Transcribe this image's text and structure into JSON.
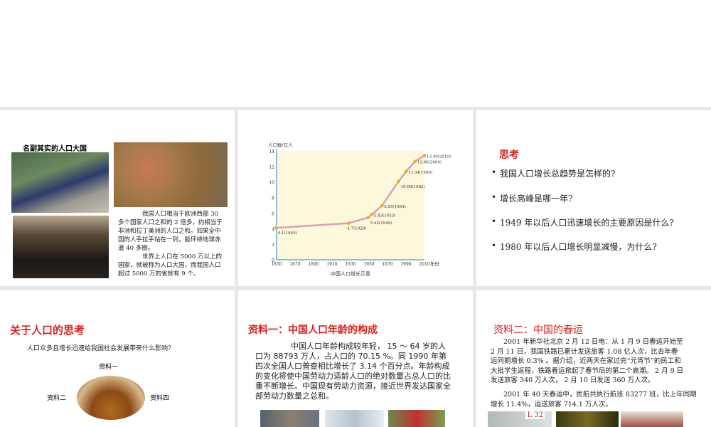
{
  "slide1": {
    "title": "名副其实的人口大国",
    "para1": "我国人口相当于欧洲西部 30 多个国家人口之和的 2 倍多，约相当于非洲和拉丁美洲的人口之和。如果全中国的人手拉手站在一列，能环绕地球赤道 40 多圈。",
    "para2": "世界上人口在 5000 万以上的国家，就被称为人口大国，而我国人口超过 5000 万的省就有 9 个。"
  },
  "chart_data": {
    "type": "line",
    "title": "中国人口增长示意",
    "ylabel": "人口数/亿人",
    "xlabel": "年份",
    "xlim": [
      1850,
      2010
    ],
    "ylim": [
      0,
      14
    ],
    "xticks": [
      "1850",
      "1870",
      "1890",
      "1910",
      "1930",
      "1950",
      "1970",
      "1990",
      "2010"
    ],
    "yticks": [
      "0",
      "2",
      "4",
      "6",
      "8",
      "10",
      "12",
      "14"
    ],
    "points": [
      {
        "year": 1849,
        "value": 4.1,
        "label": "4.1(1849)"
      },
      {
        "year": 1928,
        "value": 4.7,
        "label": "4.7(1928)"
      },
      {
        "year": 1949,
        "value": 5.42,
        "label": "5.42(1949)"
      },
      {
        "year": 1953,
        "value": 5.83,
        "label": "5.83(1953)"
      },
      {
        "year": 1964,
        "value": 6.95,
        "label": "6.95(1964)"
      },
      {
        "year": 1982,
        "value": 10.08,
        "label": "10.08(1982)"
      },
      {
        "year": 1990,
        "value": 11.34,
        "label": "11.34(1990)"
      },
      {
        "year": 2000,
        "value": 12.66,
        "label": "12.66(2000)"
      },
      {
        "year": 2010,
        "value": 13.4,
        "label": "13.40(2010)"
      }
    ],
    "line_color": "#d9a0b8",
    "point_color": "#f0a830",
    "bg_color": "#fdf8dc"
  },
  "slide3": {
    "title": "思考",
    "questions": [
      "我国人口增长总趋势是怎样的?",
      "增长高峰是哪一年?",
      "1949 年以后人口迅速增长的主要原因是什么?",
      "1980 年以后人口增长明显减慢，为什么?"
    ]
  },
  "slide4": {
    "title": "关于人口的思考",
    "question": "人口众多且增长迅速给我国社会发展带来什么影响?",
    "m1": "资料一",
    "m2": "资料二",
    "m4": "资料四"
  },
  "slide5": {
    "title": "资料一：中国人口年龄的构成",
    "body": "中国人口年龄构成较年轻， 15 ～ 64 岁的人口为 88793 万人，占人口的 70.15 %。同 1990 年第四次全国人口普查相比增长了 3.14 个百分点。年龄构成的变化将使中国劳动力适龄人口的绝对数量占总人口的比重不断增长。中国现有劳动力资源，接近世界发达国家全部劳动力数量之总和。"
  },
  "slide6": {
    "title": "资料二：中国的春运",
    "para1": "2001 年新华社北京 2 月 12 日电：从 1 月 9 日春运开始至 2 月 11 日，我国铁路已累计发送旅客 1.08 亿人次，比去年春运同期增长 0.3% 。据介绍，近两天在家过完“元宵节”的民工和大批学生返程，铁路春运掀起了春节后的第二个高潮。 2 月 9 日发送旅客 340 万人次， 2 月 10 日发送 360 万人次。",
    "para2": "2001 年 40 天春运中，民航共执行航班 83277 班，比上年同期增长 11.4%，运送旅客 714.1 万人次。",
    "sign": "L 32"
  }
}
